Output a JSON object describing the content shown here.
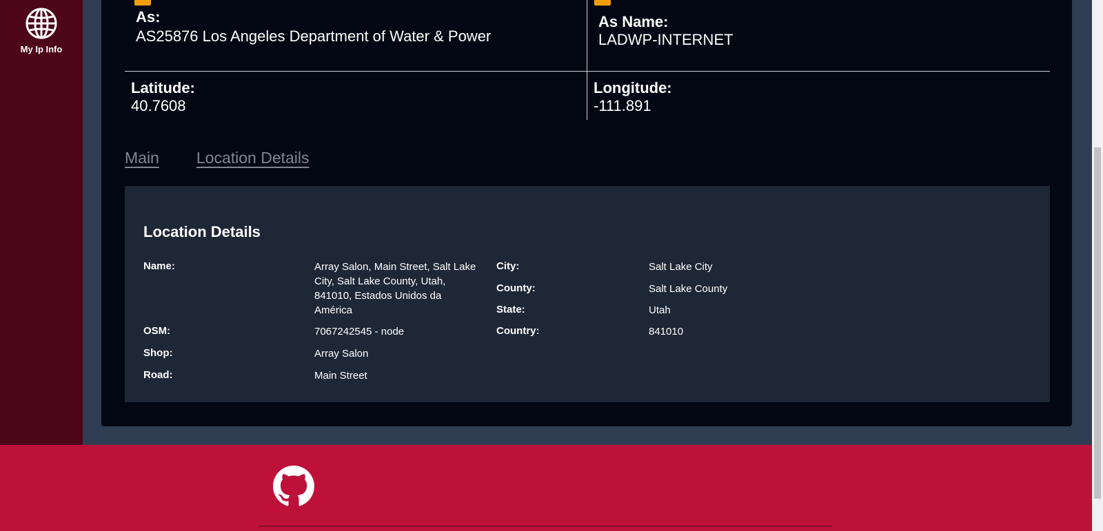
{
  "sidebar": {
    "logo_icon": "globe-icon",
    "title": "My Ip Info"
  },
  "info": {
    "as_label": "As:",
    "as_value": "AS25876 Los Angeles Department of Water & Power",
    "as_name_label": "As Name:",
    "as_name_value": "LADWP-INTERNET",
    "latitude_label": "Latitude:",
    "latitude_value": "40.7608",
    "longitude_label": "Longitude:",
    "longitude_value": "-111.891"
  },
  "tabs": [
    {
      "label": "Main"
    },
    {
      "label": "Location Details"
    }
  ],
  "location_details": {
    "title": "Location Details",
    "name_label": "Name:",
    "name_value": "Array Salon, Main Street, Salt Lake City, Salt Lake County, Utah, 841010, Estados Unidos da América",
    "osm_label": "OSM:",
    "osm_value": "7067242545 - node",
    "shop_label": "Shop:",
    "shop_value": "Array Salon",
    "road_label": "Road:",
    "road_value": "Main Street",
    "city_label": "City:",
    "city_value": "Salt Lake City",
    "county_label": "County:",
    "county_value": "Salt Lake County",
    "state_label": "State:",
    "state_value": "Utah",
    "country_label": "Country:",
    "country_value": "841010"
  },
  "footer": {
    "icon": "github-icon"
  },
  "colors": {
    "sidebar": "#4c0618",
    "card": "#020713",
    "panel": "#1e2736",
    "footer": "#bd113a",
    "badge": "#f59e0b"
  }
}
